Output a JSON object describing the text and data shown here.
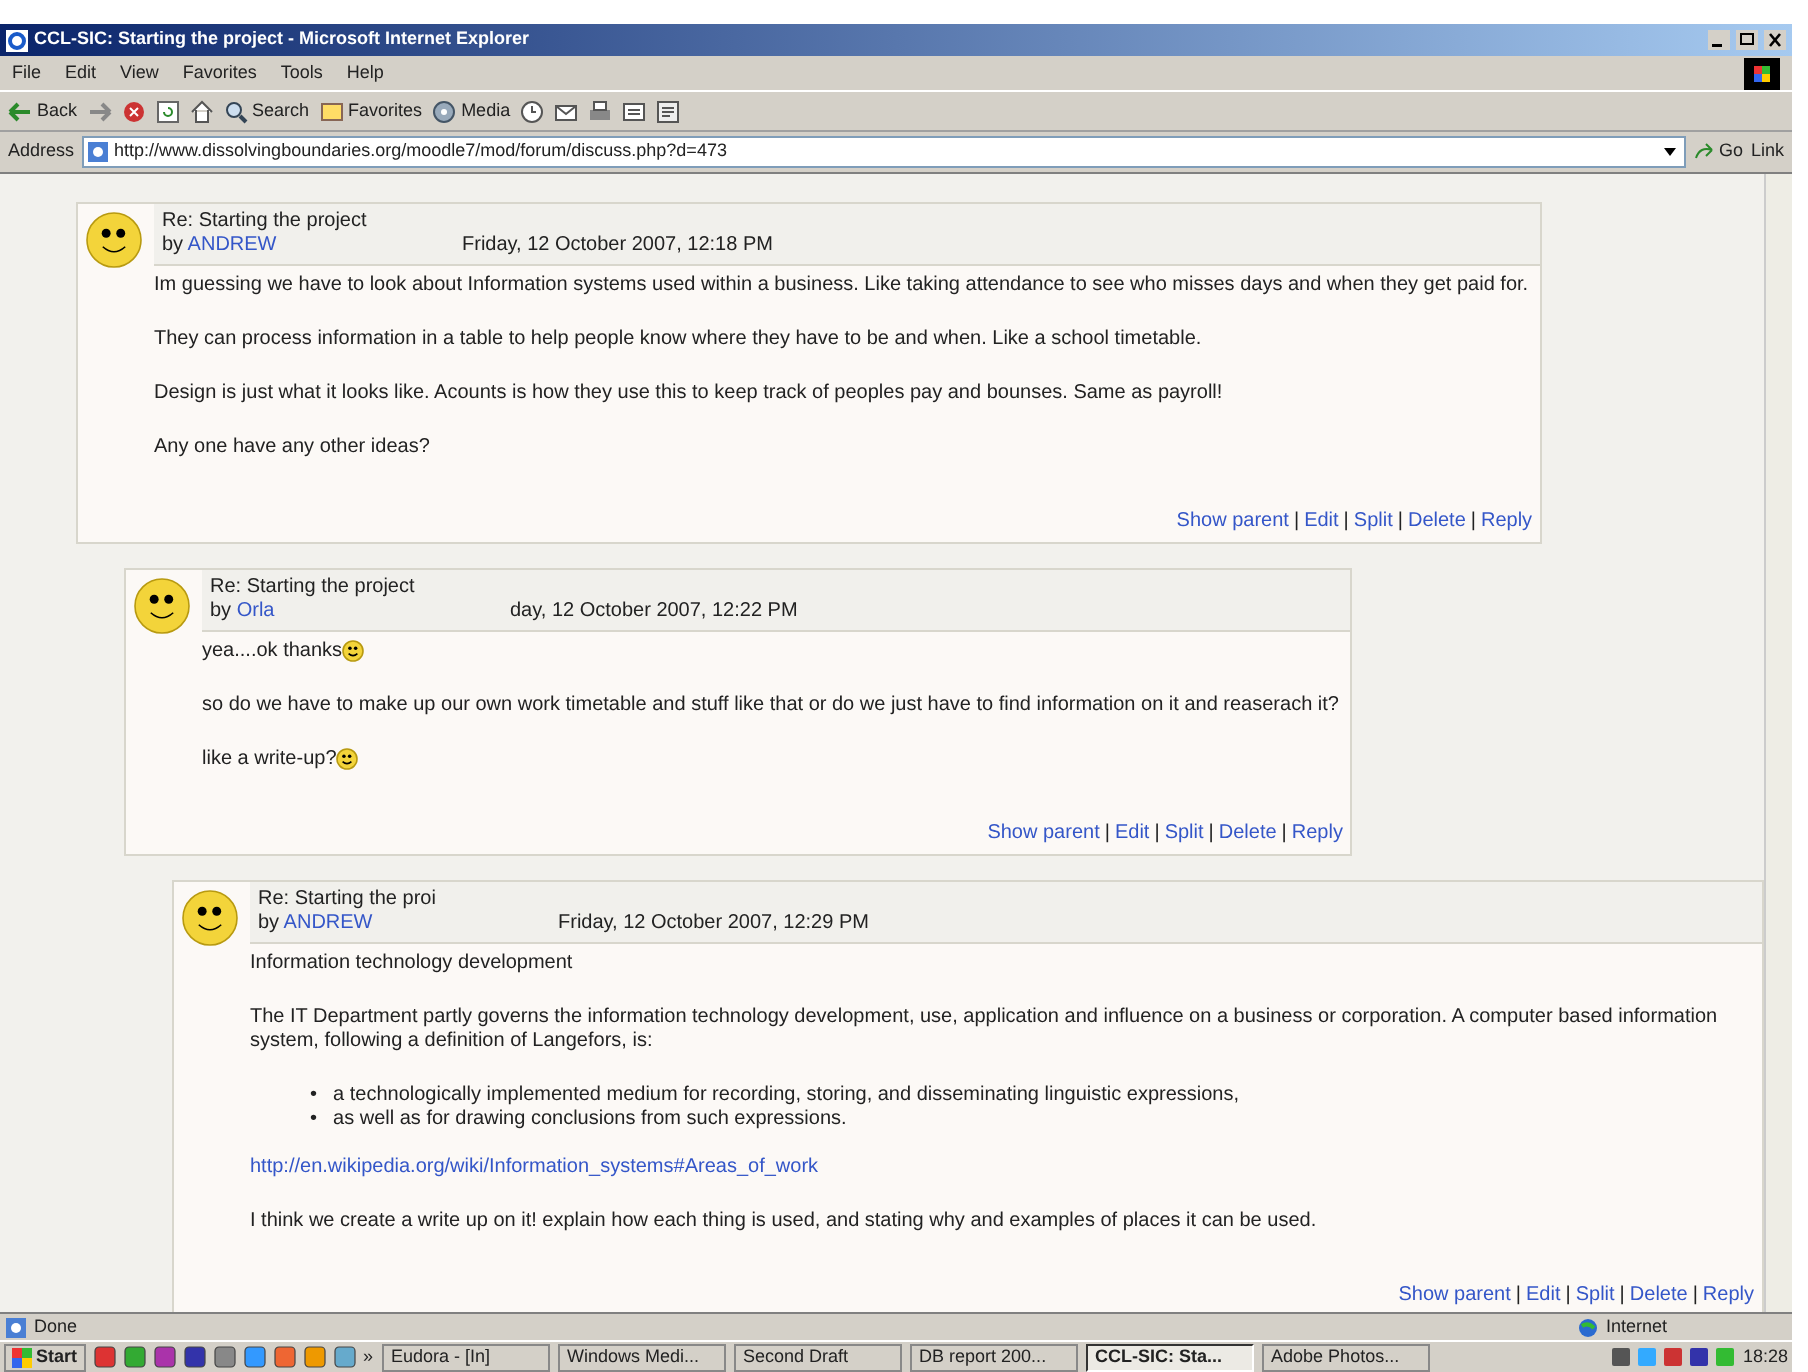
{
  "window": {
    "title": "CCL-SIC: Starting the project - Microsoft Internet Explorer"
  },
  "menu": [
    "File",
    "Edit",
    "View",
    "Favorites",
    "Tools",
    "Help"
  ],
  "toolbar": [
    {
      "kind": "back",
      "label": "Back"
    },
    {
      "kind": "forward"
    },
    {
      "kind": "stop"
    },
    {
      "kind": "refresh"
    },
    {
      "kind": "home"
    },
    {
      "kind": "search",
      "label": "Search"
    },
    {
      "kind": "favorites",
      "label": "Favorites"
    },
    {
      "kind": "media",
      "label": "Media"
    },
    {
      "kind": "history"
    },
    {
      "kind": "mail"
    },
    {
      "kind": "print"
    },
    {
      "kind": "edit"
    },
    {
      "kind": "discuss"
    }
  ],
  "address": {
    "label": "Address",
    "url": "http://www.dissolvingboundaries.org/moodle7/mod/forum/discuss.php?d=473",
    "go": "Go",
    "links": "Link"
  },
  "posts": [
    {
      "subject": "Re: Starting the project",
      "by": "by",
      "author": "ANDREW",
      "date": "Friday, 12 October 2007, 12:18 PM",
      "blocks": [
        {
          "kind": "text",
          "text": "Im guessing we have to look about Information systems used within a business. Like taking attendance to see who misses days and when they get paid for.",
          "emoticon": false
        },
        {
          "kind": "text",
          "text": "They can process information in a table to help people know where they have to be and when. Like a school timetable.",
          "emoticon": false
        },
        {
          "kind": "text",
          "text": "Design is just what it looks like. Acounts is how they use this to keep track of peoples pay and bounses. Same as payroll!",
          "emoticon": false
        },
        {
          "kind": "text",
          "text": "Any one have any other ideas?",
          "emoticon": false
        }
      ],
      "actions": [
        "Show parent",
        "Edit",
        "Split",
        "Delete",
        "Reply"
      ],
      "children": [
        {
          "subject": "Re: Starting the project",
          "by": "by",
          "author": "Orla",
          "date": "day, 12 October 2007, 12:22 PM",
          "blocks": [
            {
              "kind": "text",
              "text": "yea....ok thanks",
              "emoticon": true
            },
            {
              "kind": "text",
              "text": "so do we have to make up our own work timetable and stuff like that or do we just have to find information on it and reaserach it?",
              "emoticon": false
            },
            {
              "kind": "text",
              "text": "like a write-up?",
              "emoticon": true
            }
          ],
          "actions": [
            "Show parent",
            "Edit",
            "Split",
            "Delete",
            "Reply"
          ],
          "children": [
            {
              "subject": "Re: Starting the proi",
              "by": "by",
              "author": "ANDREW",
              "date": "Friday, 12 October 2007, 12:29 PM",
              "blocks": [
                {
                  "kind": "text",
                  "text": "Information technology development",
                  "emoticon": false
                },
                {
                  "kind": "text",
                  "text": "The IT Department partly governs the information technology development, use, application and influence on a business or corporation. A computer based information system, following a definition of Langefors, is:",
                  "emoticon": false
                },
                {
                  "kind": "list",
                  "items": [
                    "a technologically implemented medium for recording, storing, and disseminating linguistic expressions,",
                    "as well as for drawing conclusions from such expressions."
                  ]
                },
                {
                  "kind": "link",
                  "text": "http://en.wikipedia.org/wiki/Information_systems#Areas_of_work"
                },
                {
                  "kind": "text",
                  "text": "I think we create a write up on it! explain how each thing is used, and stating why and examples of places it can be used.",
                  "emoticon": false
                }
              ],
              "actions": [
                "Show parent",
                "Edit",
                "Split",
                "Delete",
                "Reply"
              ]
            }
          ]
        }
      ]
    }
  ],
  "action_separator": "|",
  "bullet": "•",
  "status_bar": {
    "text": "Done",
    "zone": "Internet"
  },
  "taskbar": {
    "start": "Start",
    "more": "»",
    "tasks": [
      {
        "label": "Eudora - [In]",
        "selected": false
      },
      {
        "label": "Windows Medi...",
        "selected": false
      },
      {
        "label": "Second Draft",
        "selected": false
      },
      {
        "label": "DB report 200...",
        "selected": false
      },
      {
        "label": "CCL-SIC: Sta...",
        "selected": true
      },
      {
        "label": "Adobe Photos...",
        "selected": false
      }
    ],
    "clock": "18:28"
  }
}
